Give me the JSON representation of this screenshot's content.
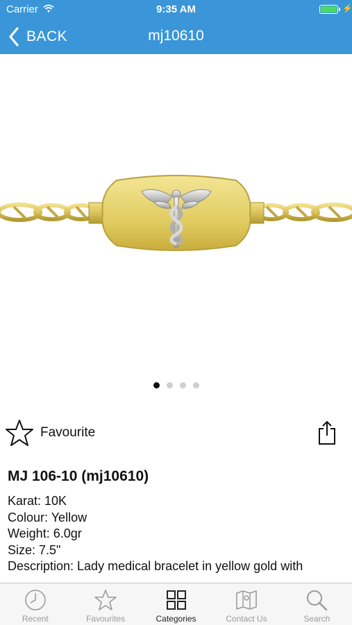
{
  "status_bar": {
    "carrier": "Carrier",
    "time": "9:35 AM",
    "battery_level": 1.0
  },
  "nav": {
    "back_label": "BACK",
    "title": "mj10610"
  },
  "gallery": {
    "image_count": 4,
    "active_index": 0
  },
  "favourite": {
    "label": "Favourite"
  },
  "product": {
    "title": "MJ 106-10 (mj10610)",
    "lines": [
      "Karat: 10K",
      "Colour: Yellow",
      "Weight: 6.0gr",
      "Size: 7.5\"",
      "Description: Lady medical bracelet in yellow gold with"
    ]
  },
  "tabs": [
    {
      "label": "Recent",
      "icon": "clock-icon",
      "active": false
    },
    {
      "label": "Favourites",
      "icon": "star-icon",
      "active": false
    },
    {
      "label": "Categories",
      "icon": "grid-icon",
      "active": true
    },
    {
      "label": "Contact Us",
      "icon": "map-icon",
      "active": false
    },
    {
      "label": "Search",
      "icon": "search-icon",
      "active": false
    }
  ],
  "colors": {
    "nav": "#3a96d8",
    "gold": "#d9c25a",
    "tab_inactive": "#9a9a9a",
    "tab_active": "#222222"
  }
}
